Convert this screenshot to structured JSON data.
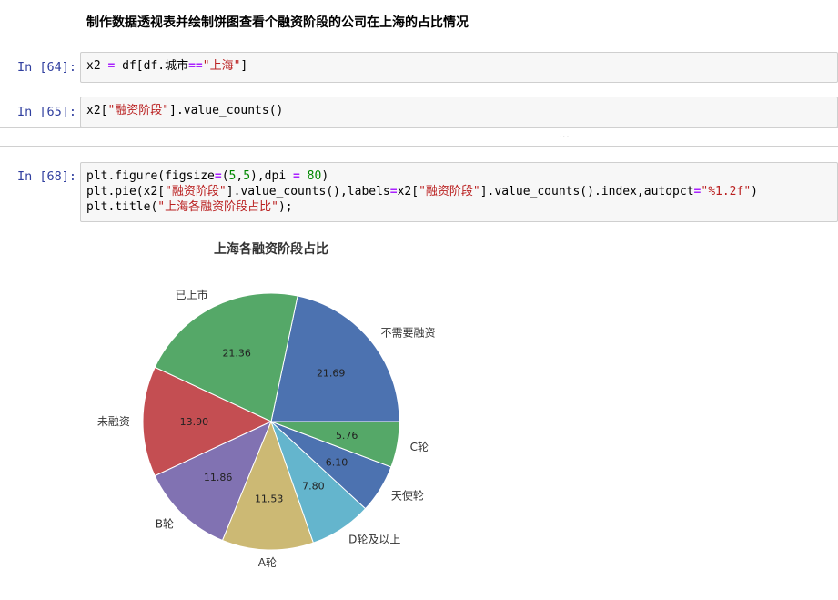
{
  "markdown": {
    "text": "制作数据透视表并绘制饼图查看个融资阶段的公司在上海的占比情况"
  },
  "cells": [
    {
      "prompt": "In [64]:",
      "code": [
        [
          [
            "x2 ",
            "plain"
          ],
          [
            "=",
            "op"
          ],
          [
            " df[df.城市",
            "plain"
          ],
          [
            "==",
            "op"
          ],
          [
            "\"上海\"",
            "str"
          ],
          [
            "]",
            "plain"
          ]
        ]
      ]
    },
    {
      "prompt": "In [65]:",
      "code": [
        [
          [
            "x2[",
            "plain"
          ],
          [
            "\"融资阶段\"",
            "str"
          ],
          [
            "].value_counts()",
            "plain"
          ]
        ]
      ]
    },
    {
      "prompt": "In [68]:",
      "code": [
        [
          [
            "plt.figure(figsize",
            "plain"
          ],
          [
            "=",
            "op"
          ],
          [
            "(",
            "plain"
          ],
          [
            "5",
            "num"
          ],
          [
            ",",
            "plain"
          ],
          [
            "5",
            "num"
          ],
          [
            "),dpi ",
            "plain"
          ],
          [
            "=",
            "op"
          ],
          [
            " ",
            "plain"
          ],
          [
            "80",
            "num"
          ],
          [
            ")",
            "plain"
          ]
        ],
        [
          [
            "plt.pie(x2[",
            "plain"
          ],
          [
            "\"融资阶段\"",
            "str"
          ],
          [
            "].value_counts(),labels",
            "plain"
          ],
          [
            "=",
            "op"
          ],
          [
            "x2[",
            "plain"
          ],
          [
            "\"融资阶段\"",
            "str"
          ],
          [
            "].value_counts().index,autopct",
            "plain"
          ],
          [
            "=",
            "op"
          ],
          [
            "\"%1.2f\"",
            "str"
          ],
          [
            ")",
            "plain"
          ]
        ],
        [
          [
            "plt.title(",
            "plain"
          ],
          [
            "\"上海各融资阶段占比\"",
            "str"
          ],
          [
            ");",
            "plain"
          ]
        ]
      ]
    }
  ],
  "collapsed_output": {
    "dots": "..."
  },
  "chart_data": {
    "type": "pie",
    "title": "上海各融资阶段占比",
    "categories": [
      "不需要融资",
      "已上市",
      "未融资",
      "B轮",
      "A轮",
      "D轮及以上",
      "天使轮",
      "C轮"
    ],
    "values": [
      21.69,
      21.36,
      13.9,
      11.86,
      11.53,
      7.8,
      6.1,
      5.76
    ],
    "labels": [
      "21.69",
      "21.36",
      "13.90",
      "11.86",
      "11.53",
      "7.80",
      "6.10",
      "5.76"
    ],
    "colors": [
      "#4c72b0",
      "#55a868",
      "#c44e52",
      "#8172b2",
      "#ccb974",
      "#64b5cd",
      "#4c72b0",
      "#55a868"
    ],
    "start_angle_deg": 0,
    "direction": "counterclockwise"
  }
}
